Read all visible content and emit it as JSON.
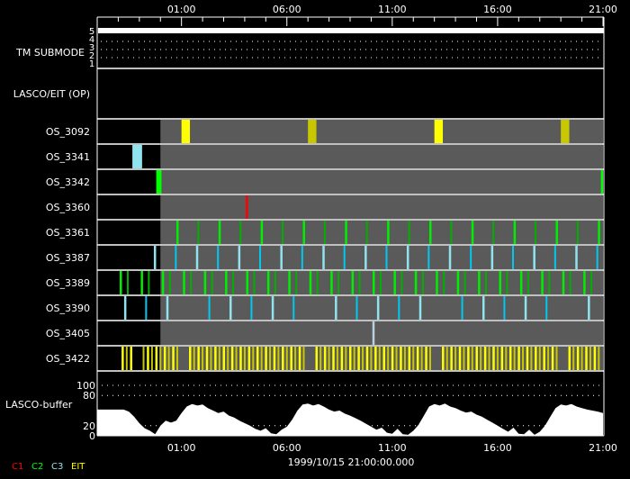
{
  "chart_data": {
    "type": "timeline",
    "time_axis": {
      "start_hour_offset": 0,
      "end_hour_offset": 24,
      "start_label_clock": "21:00",
      "major_ticks": [
        {
          "h": 4,
          "label": "01:00"
        },
        {
          "h": 9,
          "label": "06:00"
        },
        {
          "h": 14,
          "label": "11:00"
        },
        {
          "h": 19,
          "label": "16:00"
        },
        {
          "h": 24,
          "label": "21:00"
        }
      ],
      "minor_tick_step_hours": 1
    },
    "date_label": "1999/10/15 21:00:00.000",
    "tm_submode": {
      "label": "TM SUBMODE",
      "levels": [
        "5",
        "4",
        "3",
        "2",
        "1"
      ],
      "value": 5
    },
    "lasco_eit_op": {
      "label": "LASCO/EIT (OP)"
    },
    "schedule_start_h": 3.0,
    "rows": [
      {
        "label": "OS_3092",
        "blocks": [
          {
            "from": 4.0,
            "to": 4.4,
            "color": "#ffff00"
          },
          {
            "from": 10.0,
            "to": 10.4,
            "color": "#c8c800"
          },
          {
            "from": 16.0,
            "to": 16.4,
            "color": "#ffff00"
          },
          {
            "from": 22.0,
            "to": 22.4,
            "color": "#c8c800"
          }
        ]
      },
      {
        "label": "OS_3341",
        "blocks": [
          {
            "from": 1.67,
            "to": 2.13,
            "color": "#90e4f0"
          }
        ]
      },
      {
        "label": "OS_3342",
        "blocks": [
          {
            "from": 2.8,
            "to": 3.05,
            "color": "#00ff00"
          },
          {
            "from": 23.9,
            "to": 24.0,
            "color": "#00ff00"
          }
        ]
      },
      {
        "label": "OS_3360",
        "lines": {
          "times": [
            7.09
          ],
          "colors": [
            "#ff0000"
          ]
        }
      },
      {
        "label": "OS_3361",
        "lines": {
          "periodic": {
            "start": 3.8,
            "step": 1,
            "count": 21
          },
          "colors": [
            "#00ee00",
            "#00b000"
          ]
        }
      },
      {
        "label": "OS_3387",
        "lines": {
          "periodic": {
            "start": 2.73,
            "step": 1,
            "count": 22
          },
          "colors": [
            "#90e4f0",
            "#00c8f0"
          ]
        }
      },
      {
        "label": "OS_3389",
        "lines": {
          "periodic": {
            "start": 1.11,
            "step": 1,
            "count": 23,
            "pair_offset": 0.34
          },
          "colors": [
            "#00ee00",
            "#00b000"
          ]
        }
      },
      {
        "label": "OS_3390",
        "lines": {
          "periodic": {
            "start": 1.32,
            "step": 1,
            "count": 23,
            "skip": [
              3,
              9,
              15,
              21
            ]
          },
          "colors": [
            "#90e4f0",
            "#00c8f0"
          ]
        }
      },
      {
        "label": "OS_3405",
        "lines": {
          "times": [
            13.1
          ],
          "colors": [
            "#b8d0e0"
          ]
        }
      },
      {
        "label": "OS_3422",
        "lines": {
          "ranges": [
            {
              "from": 1.2,
              "to": 1.6
            },
            {
              "from": 2.2,
              "to": 3.8
            },
            {
              "from": 4.4,
              "to": 9.8
            },
            {
              "from": 10.4,
              "to": 15.8
            },
            {
              "from": 16.4,
              "to": 21.8
            },
            {
              "from": 22.4,
              "to": 23.9
            }
          ],
          "step": 0.2,
          "colors": [
            "#ffff00",
            "#c8c800"
          ]
        }
      }
    ],
    "buffer": {
      "label": "LASCO-buffer",
      "y_ticks": [
        "100",
        "80",
        "20",
        "0"
      ],
      "y_tick_values": [
        100,
        80,
        20,
        0
      ],
      "ylim": [
        0,
        100
      ],
      "step_hours": 0.25,
      "values": [
        52,
        52,
        52,
        52,
        52,
        52,
        48,
        38,
        25,
        15,
        10,
        3,
        20,
        30,
        26,
        30,
        45,
        58,
        63,
        60,
        62,
        55,
        50,
        45,
        48,
        40,
        36,
        30,
        25,
        20,
        14,
        10,
        15,
        5,
        3,
        12,
        18,
        32,
        50,
        62,
        64,
        60,
        63,
        58,
        52,
        48,
        50,
        44,
        40,
        35,
        30,
        24,
        18,
        12,
        16,
        6,
        4,
        14,
        3,
        2,
        10,
        22,
        40,
        58,
        63,
        60,
        64,
        58,
        55,
        50,
        46,
        48,
        42,
        38,
        32,
        26,
        20,
        14,
        8,
        16,
        4,
        3,
        12,
        2,
        8,
        20,
        38,
        55,
        62,
        60,
        63,
        58,
        55,
        52,
        50,
        48,
        45
      ]
    },
    "legend": [
      {
        "label": "C1",
        "color": "#ff0000"
      },
      {
        "label": "C2",
        "color": "#00ff00"
      },
      {
        "label": "C3",
        "color": "#90e4f0"
      },
      {
        "label": "EIT",
        "color": "#ffff00"
      }
    ]
  }
}
